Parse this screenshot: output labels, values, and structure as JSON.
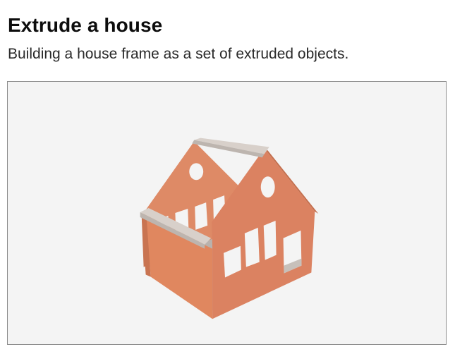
{
  "header": {
    "title": "Extrude a house",
    "subtitle": "Building a house frame as a set of extruded objects."
  },
  "scene": {
    "wall_color": "#e08a66",
    "wall_shade_color": "#d77d58",
    "floor_color": "#b9b2ad",
    "beam_color": "#d4ccc6",
    "background": "#f4f4f4",
    "border": "#8c8c8c"
  }
}
